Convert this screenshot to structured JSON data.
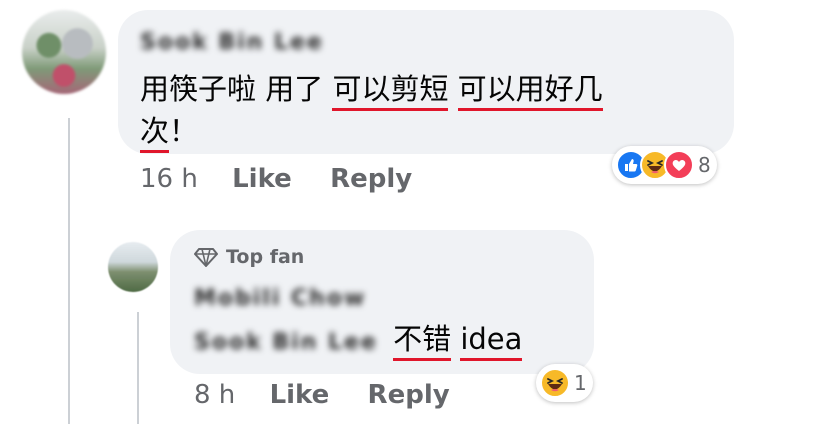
{
  "comment": {
    "author_blurred": "Sook Bin Lee",
    "text_line1_a": "用筷子啦 用了",
    "text_line1_b": "可以剪短",
    "text_line1_c": "可以用好几",
    "text_line2_a": "次",
    "text_line2_b": "！",
    "time": "16 h",
    "like_label": "Like",
    "reply_label": "Reply",
    "reaction_count": "8",
    "reactions": [
      "like-icon",
      "haha-icon",
      "love-icon"
    ]
  },
  "reply": {
    "badge": "Top fan",
    "author_blurred": "Mobili Chow",
    "mention_blurred": "Sook Bin Lee",
    "text_a": "不错",
    "text_b": "idea",
    "time": "8 h",
    "like_label": "Like",
    "reply_label": "Reply",
    "reaction_count": "1",
    "reactions": [
      "haha-icon"
    ]
  },
  "colors": {
    "bubble": "#f0f2f5",
    "meta_text": "#65676b",
    "underline": "#e0162b",
    "like_blue": "#1877f2",
    "haha_yellow": "#f7b928",
    "love_red": "#f33e58"
  }
}
